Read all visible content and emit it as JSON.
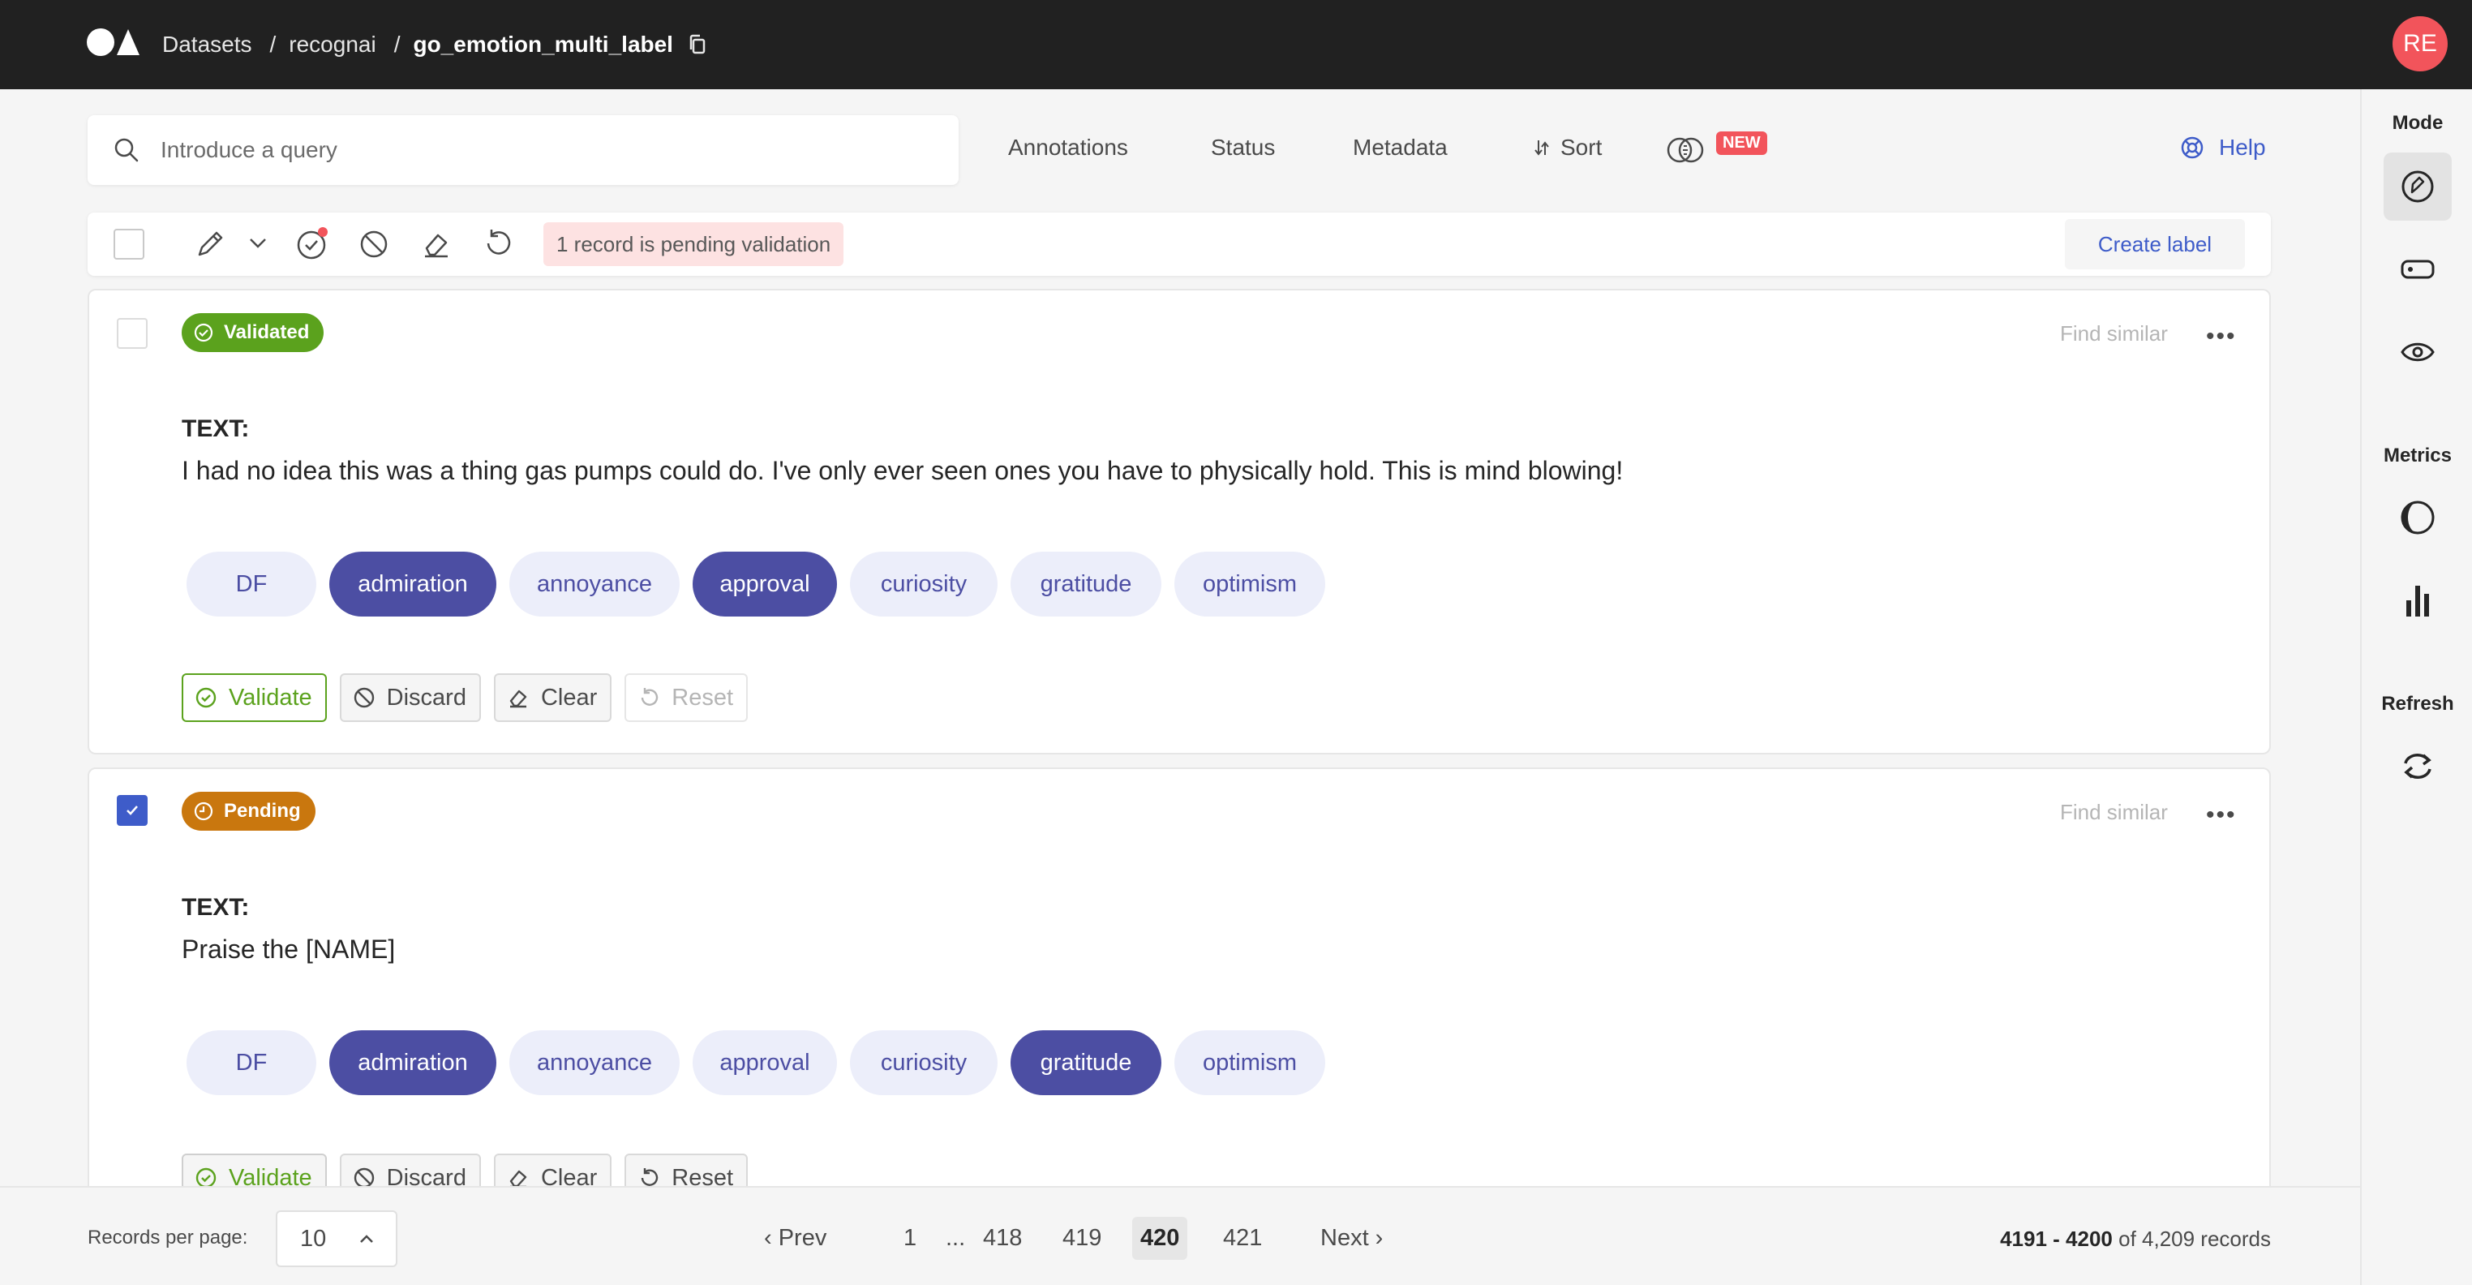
{
  "header": {
    "breadcrumb": [
      "Datasets",
      "recognai",
      "go_emotion_multi_label"
    ],
    "avatar_initials": "RE"
  },
  "search": {
    "placeholder": "Introduce a query"
  },
  "filters": [
    "Annotations",
    "Status",
    "Metadata",
    "Sort"
  ],
  "new_badge": "NEW",
  "help_label": "Help",
  "toolbar": {
    "pending_note": "1 record is pending validation",
    "create_label": "Create label"
  },
  "sidebar": {
    "mode_title": "Mode",
    "metrics_title": "Metrics",
    "refresh_title": "Refresh"
  },
  "records": [
    {
      "status": "Validated",
      "status_color": "#5ba21d",
      "checked": false,
      "field_label": "TEXT:",
      "text": "I had no idea this was a thing gas pumps could do. I've only ever seen ones you have to physically hold. This is mind blowing!",
      "labels": [
        "DF",
        "admiration",
        "annoyance",
        "approval",
        "curiosity",
        "gratitude",
        "optimism"
      ],
      "selected": [
        "admiration",
        "approval"
      ]
    },
    {
      "status": "Pending",
      "status_color": "#c9770e",
      "checked": true,
      "field_label": "TEXT:",
      "text": "Praise the [NAME]",
      "labels": [
        "DF",
        "admiration",
        "annoyance",
        "approval",
        "curiosity",
        "gratitude",
        "optimism"
      ],
      "selected": [
        "admiration",
        "gratitude"
      ]
    }
  ],
  "record_actions": {
    "find_similar": "Find similar",
    "more": "•••",
    "validate": "Validate",
    "discard": "Discard",
    "clear": "Clear",
    "reset": "Reset"
  },
  "footer": {
    "records_per_page_label": "Records per page:",
    "records_per_page": "10",
    "prev": "‹  Prev",
    "next": "Next  ›",
    "first_page": "1",
    "ellipsis": "...",
    "pages": [
      "418",
      "419",
      "420",
      "421"
    ],
    "current_page": "420",
    "range": "4191 - 4200",
    "range_suffix": "of 4,209 records"
  }
}
